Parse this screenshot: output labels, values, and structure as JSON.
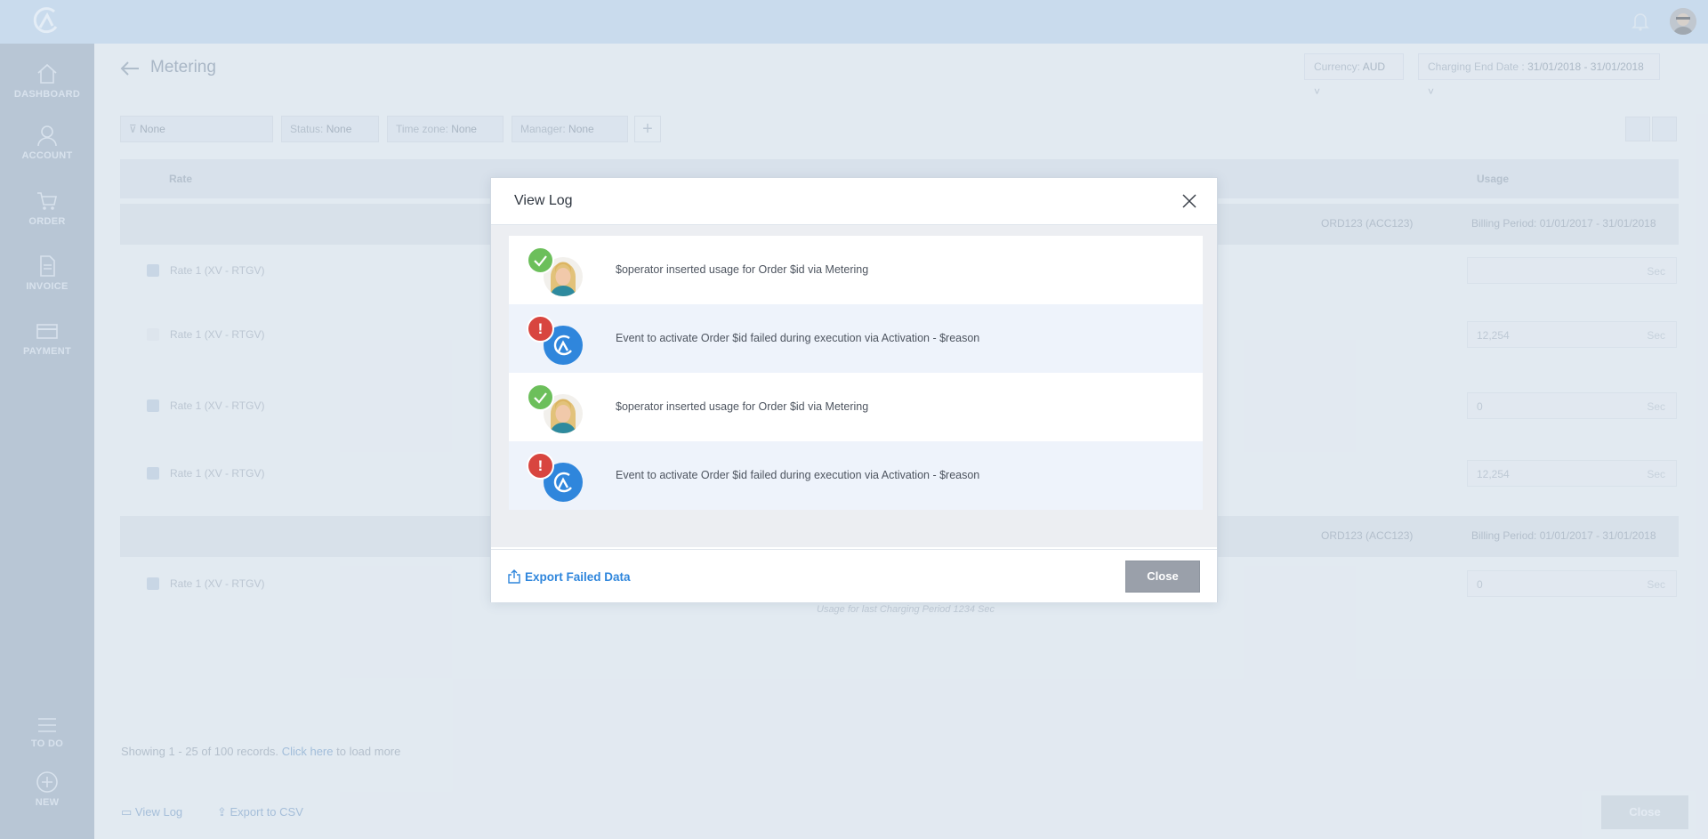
{
  "sidebar": {
    "items": [
      {
        "label": "DASHBOARD",
        "icon": "home-icon"
      },
      {
        "label": "ACCOUNT",
        "icon": "user-icon"
      },
      {
        "label": "ORDER",
        "icon": "cart-icon"
      },
      {
        "label": "INVOICE",
        "icon": "document-icon"
      },
      {
        "label": "PAYMENT",
        "icon": "card-icon"
      }
    ],
    "bottom_items": [
      {
        "label": "TO DO",
        "icon": "list-icon"
      },
      {
        "label": "NEW",
        "icon": "plus-circle-icon"
      }
    ]
  },
  "header": {
    "title": "Metering",
    "currency_label": "Currency:",
    "currency_value": "AUD",
    "charging_label": "Charging End Date :",
    "charging_value": "31/01/2018 - 31/01/2018"
  },
  "filters": [
    {
      "label": "",
      "value": "None"
    },
    {
      "label": "Status:",
      "value": "None"
    },
    {
      "label": "Time zone:",
      "value": "None"
    },
    {
      "label": "Manager:",
      "value": "None"
    }
  ],
  "table": {
    "columns": [
      "Rate",
      "Usage"
    ],
    "groups": [
      {
        "order": "ORD123 (ACC123)",
        "billing": "Billing Period: 01/01/2017 - 31/01/2018",
        "rows": [
          {
            "rate": "Rate 1 (XV - RTGV)",
            "usage": "",
            "unit": "Sec",
            "checked": true
          },
          {
            "rate": "Rate 1 (XV - RTGV)",
            "usage": "12,254",
            "unit": "Sec",
            "checked": false
          },
          {
            "rate": "Rate 1 (XV - RTGV)",
            "usage": "0",
            "unit": "Sec",
            "checked": true
          },
          {
            "rate": "Rate 1 (XV - RTGV)",
            "usage": "12,254",
            "unit": "Sec",
            "checked": true
          }
        ]
      },
      {
        "order": "ORD123 (ACC123)",
        "billing": "Billing Period: 01/01/2017 - 31/01/2018",
        "rows": [
          {
            "rate": "Rate 1 (XV - RTGV)",
            "usage": "0",
            "unit": "Sec",
            "checked": true
          }
        ]
      }
    ],
    "caption": "Usage for last Charging Period 1234 Sec"
  },
  "records": {
    "text": "Showing 1 - 25 of 100 records.",
    "link": "Click here",
    "suffix": "to load more"
  },
  "footer": {
    "view_log": "View Log",
    "export_csv": "Export to CSV",
    "close": "Close"
  },
  "modal": {
    "title": "View Log",
    "entries": [
      {
        "status": "success",
        "actor": "operator-photo",
        "text": "$operator inserted usage for Order $id via Metering"
      },
      {
        "status": "error",
        "actor": "app",
        "text": "Event to activate Order $id failed during execution via Activation - $reason"
      },
      {
        "status": "success",
        "actor": "operator-photo",
        "text": "$operator inserted usage for Order $id via Metering"
      },
      {
        "status": "error",
        "actor": "app",
        "text": "Event to activate Order $id failed during execution via Activation - $reason"
      }
    ],
    "export_label": "Export Failed Data",
    "close_label": "Close"
  },
  "colors": {
    "accent": "#2f86dc",
    "success": "#6cbf5b",
    "error": "#d8453f"
  }
}
